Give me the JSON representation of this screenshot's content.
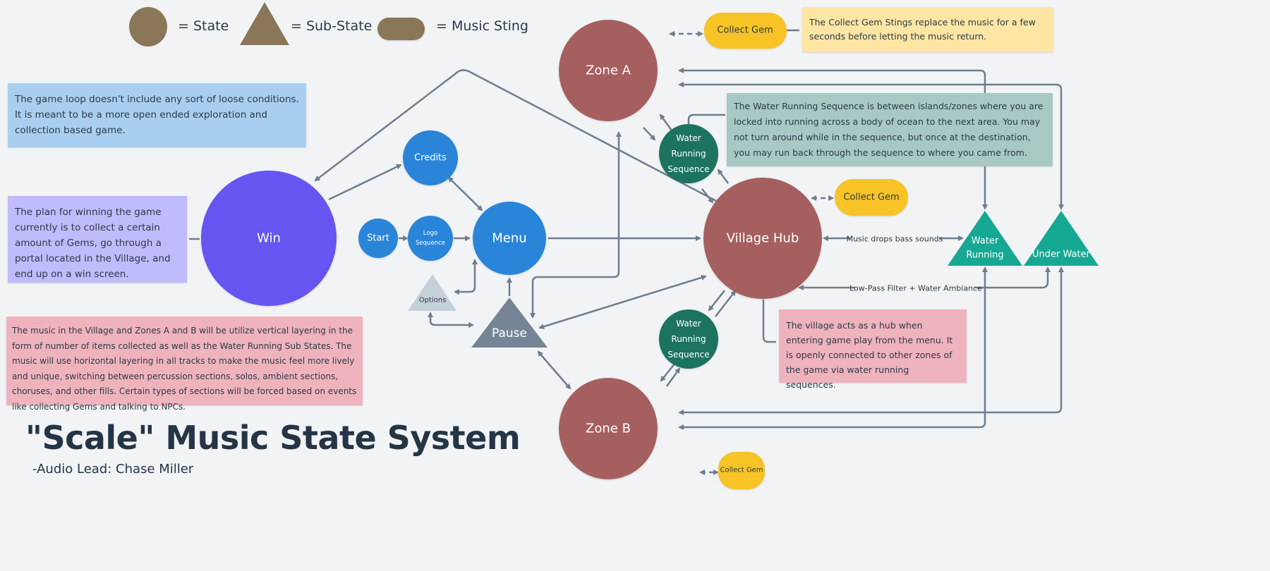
{
  "legend": {
    "state_label": "=  State",
    "substate_label": "=  Sub-State",
    "sting_label": "=  Music Sting",
    "color": "#8a7758"
  },
  "title": "\"Scale\" Music State System",
  "subtitle": "-Audio Lead: Chase Miller",
  "notes": {
    "game_loop": "The game loop doesn't include any sort of loose conditions.  It is meant to be a more open ended exploration and collection based game.",
    "winning": "The plan for winning the game currently is to collect a certain amount of Gems, go through a portal located in the Village, and end up on a win screen.",
    "layering": "The music in the Village and Zones A and B will be utilize vertical layering in the form of number of items collected as well as the Water Running Sub States.  The music will use horizontal layering in all tracks to make the music feel more lively and unique, switching between percussion sections, solos, ambient sections, choruses, and other fills.  Certain types of sections will be forced based on events like collecting Gems and talking to NPCs.",
    "collect_gem": "The Collect Gem Stings replace the music for a few seconds before letting the music return.",
    "water_running": "The Water Running Sequence is between islands/zones where you are locked into running across a body of ocean to the next area.  You may not turn around while in the sequence, but once at the destination, you may run back through the sequence to where you came from.",
    "village": "The village acts as a hub when entering game play from the menu.  It is openly connected to other zones of the game via water running sequences."
  },
  "nodes": {
    "win": "Win",
    "credits": "Credits",
    "start": "Start",
    "logo_line1": "Logo",
    "logo_line2": "Sequence",
    "menu": "Menu",
    "options": "Options",
    "pause": "Pause",
    "zone_a": "Zone A",
    "zone_b": "Zone B",
    "village_hub": "Village Hub",
    "wrs_line1": "Water",
    "wrs_line2": "Running",
    "wrs_line3": "Sequence",
    "collect_gem": "Collect Gem",
    "water_running_line1": "Water",
    "water_running_line2": "Running",
    "under_water": "Under Water"
  },
  "edge_labels": {
    "bass": "Music drops bass sounds",
    "lowpass": "Low-Pass Filter + Water Ambiance"
  },
  "colors": {
    "background": "#f1f3f5",
    "win": "#6654f1",
    "menu_states": "#2a85d8",
    "zones": "#a65e5e",
    "wrs": "#1f7360",
    "gem": "#f7c325",
    "substate_water": "#17a893",
    "pause": "#768595",
    "options": "#c5d0d9",
    "note_blue": "#a9cff0",
    "note_purple": "#c0bbfb",
    "note_pink": "#efb3bd",
    "note_yellow": "#fde6a4",
    "note_teal": "#a7c8c3",
    "edge": "#6f7e8d"
  }
}
